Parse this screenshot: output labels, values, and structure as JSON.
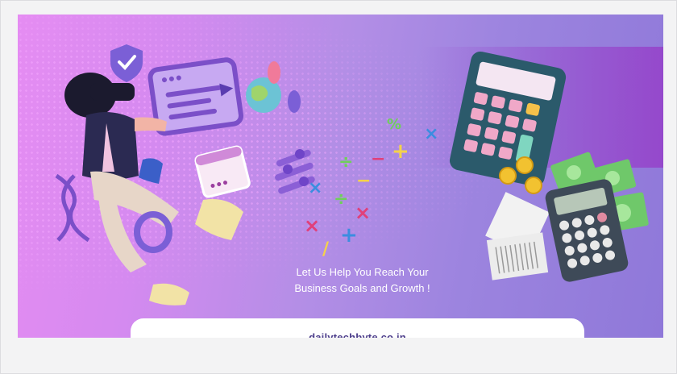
{
  "banner": {
    "tagline_line1": "Let Us Help You Reach Your",
    "tagline_line2": "Business Goals and Growth !",
    "website": "dailytechbyte.co.in",
    "colors": {
      "gradient_start": "#e58cf2",
      "gradient_end": "#8f78d9",
      "accent": "#4b3c8a"
    }
  }
}
